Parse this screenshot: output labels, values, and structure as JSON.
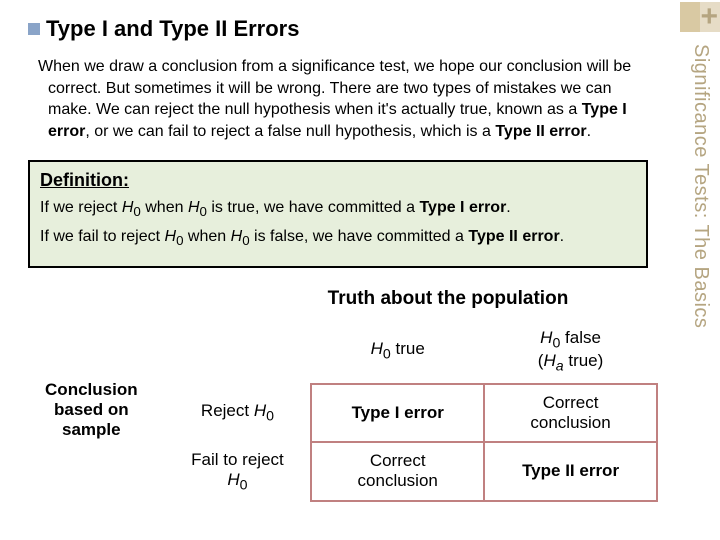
{
  "sidebar": {
    "plus": "+",
    "label": "Significance Tests: The Basics"
  },
  "title": "Type I and Type II Errors",
  "intro_html": "When we draw a conclusion from a significance test, we hope our conclusion will be correct. But sometimes it will be wrong. There are two types of mistakes we can make. We can reject the null hypothesis when it's actually true, known as a <b>Type I error</b>, or we can fail to reject a false null hypothesis, which is a <b>Type II error</b>.",
  "definition": {
    "heading": "Definition:",
    "line1_html": "If we reject <i>H</i><sub>0</sub> when <i>H</i><sub>0</sub> is true, we have committed a <b>Type I error</b>.",
    "line2_html": "If we fail to reject <i>H</i><sub>0</sub> when <i>H</i><sub>0</sub> is false, we have committed a <b>Type II error</b>."
  },
  "table": {
    "top_caption": "Truth about the population",
    "col1_html": "<i>H</i><sub>0</sub> true",
    "col2_html": "<i>H</i><sub>0</sub> false<br>(<i>H<sub>a</sub></i> true)",
    "side_caption_html": "Conclusion<br>based on<br>sample",
    "row1_label_html": "Reject <i>H</i><sub>0</sub>",
    "row2_label_html": "Fail to reject<br><i>H</i><sub>0</sub>",
    "cell_11": "Type I error",
    "cell_12_html": "Correct<br>conclusion",
    "cell_21_html": "Correct<br>conclusion",
    "cell_22": "Type II error"
  }
}
